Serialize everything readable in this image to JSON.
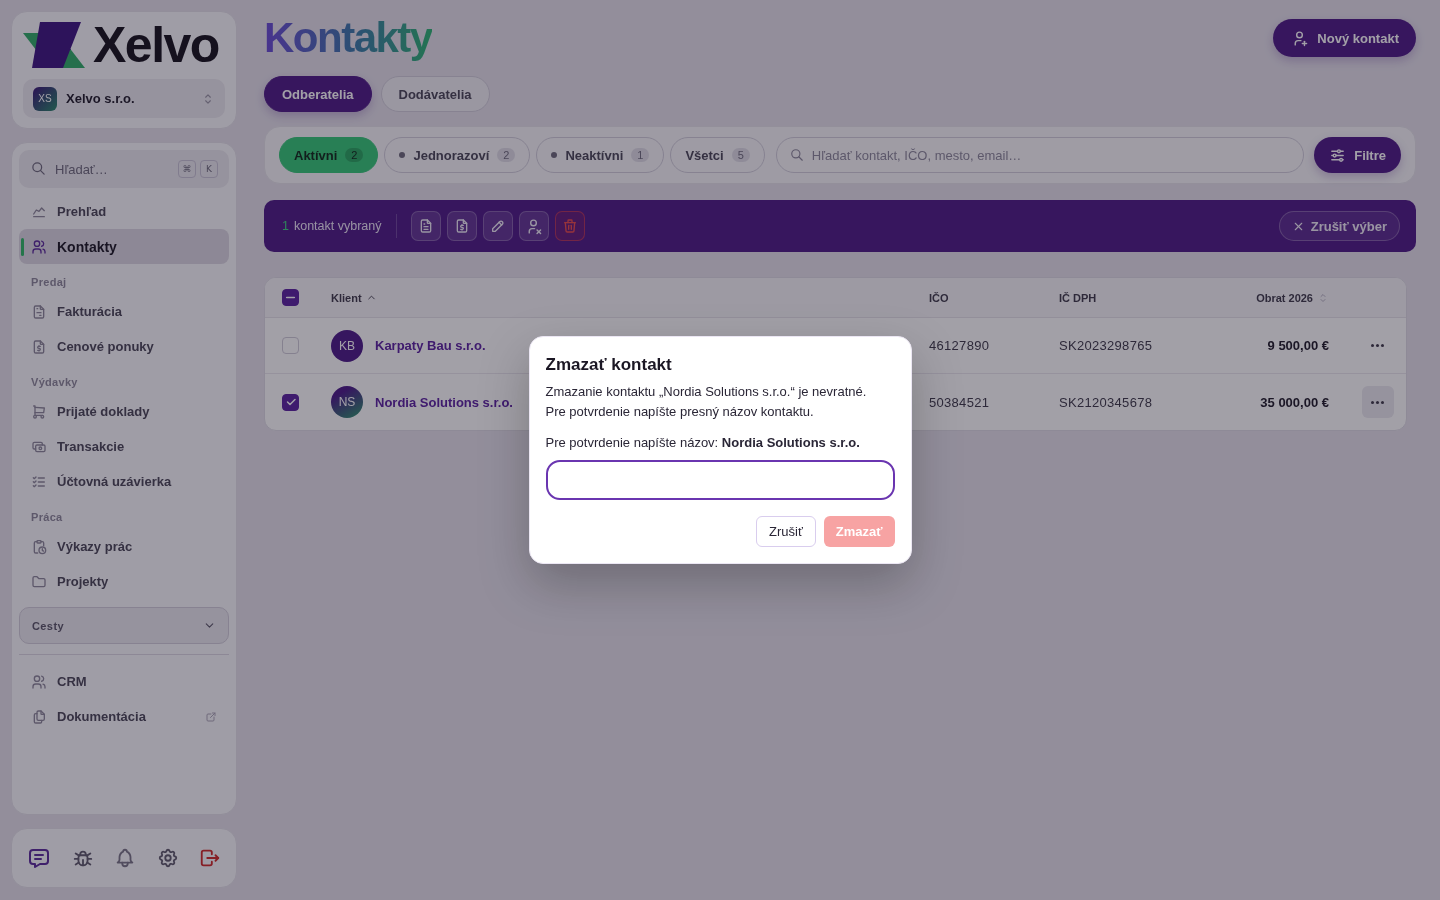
{
  "sidebar": {
    "brand": "Xelvo",
    "company": {
      "initials": "XS",
      "name": "Xelvo s.r.o."
    },
    "search": {
      "placeholder": "Hľadať…",
      "keys": [
        "⌘",
        "K"
      ]
    },
    "nav": [
      {
        "kind": "link",
        "label": "Prehľad",
        "selected": false,
        "external": false
      },
      {
        "kind": "link",
        "label": "Kontakty",
        "selected": true,
        "external": false
      },
      {
        "kind": "heading",
        "label": "Predaj"
      },
      {
        "kind": "link",
        "label": "Fakturácia",
        "selected": false,
        "external": false
      },
      {
        "kind": "link",
        "label": "Cenové ponuky",
        "selected": false,
        "external": false
      },
      {
        "kind": "heading",
        "label": "Výdavky"
      },
      {
        "kind": "link",
        "label": "Prijaté doklady",
        "selected": false,
        "external": false
      },
      {
        "kind": "link",
        "label": "Transakcie",
        "selected": false,
        "external": false
      },
      {
        "kind": "link",
        "label": "Účtovná uzávierka",
        "selected": false,
        "external": false
      },
      {
        "kind": "heading",
        "label": "Práca"
      },
      {
        "kind": "link",
        "label": "Výkazy prác",
        "selected": false,
        "external": false
      },
      {
        "kind": "link",
        "label": "Projekty",
        "selected": false,
        "external": false
      },
      {
        "kind": "group",
        "label": "Cesty",
        "expanded": false
      },
      {
        "kind": "divider"
      },
      {
        "kind": "link",
        "label": "CRM",
        "selected": false,
        "external": false
      },
      {
        "kind": "link",
        "label": "Dokumentácia",
        "selected": false,
        "external": true
      }
    ]
  },
  "header": {
    "title": "Kontakty",
    "new_button": "Nový kontakt"
  },
  "tabs": [
    {
      "label": "Odberatelia",
      "selected": true
    },
    {
      "label": "Dodávatelia",
      "selected": false
    }
  ],
  "filters": {
    "statuses": [
      {
        "label": "Aktívni",
        "count": "2",
        "selected": true,
        "dot": false
      },
      {
        "label": "Jednorazoví",
        "count": "2",
        "selected": false,
        "dot": true
      },
      {
        "label": "Neaktívni",
        "count": "1",
        "selected": false,
        "dot": true
      },
      {
        "label": "Všetci",
        "count": "5",
        "selected": false,
        "dot": false
      }
    ],
    "search": {
      "placeholder": "Hľadať kontakt, IČO, mesto, email…"
    },
    "button": "Filtre"
  },
  "selection_bar": {
    "count": "1",
    "label": "kontakt vybraný",
    "clear_button": "Zrušiť výber"
  },
  "table": {
    "select_all": {
      "indeterminate": true
    },
    "columns": [
      {
        "label": "Klient",
        "sortable": true,
        "sorted": true
      },
      {
        "label": "IČO",
        "sortable": false,
        "sorted": false
      },
      {
        "label": "IČ DPH",
        "sortable": false,
        "sorted": false
      },
      {
        "label": "Obrat 2026",
        "sortable": true,
        "sorted": false
      }
    ],
    "rows": [
      {
        "selected": false,
        "initials": "KB",
        "avatar_gradient": false,
        "name": "Karpaty Bau s.r.o.",
        "ico": "46127890",
        "ic_dph": "SK2023298765",
        "turnover": "9 500,00 €",
        "menu_highlighted": false
      },
      {
        "selected": true,
        "initials": "NS",
        "avatar_gradient": true,
        "name": "Nordia Solutions s.r.o.",
        "ico": "50384521",
        "ic_dph": "SK2120345678",
        "turnover": "35 000,00 €",
        "menu_highlighted": true
      }
    ]
  },
  "modal": {
    "title": "Zmazať kontakt",
    "message": [
      "Zmazanie kontaktu „Nordia Solutions s.r.o.“ je nevratné.",
      "Pre potvrdenie napíšte presný názov kontaktu."
    ],
    "confirm_label": "Pre potvrdenie napíšte názov: **Nordia Solutions s.r.o.**",
    "input": {
      "focused": true
    },
    "cancel_button": "Zrušiť",
    "delete_button": {
      "label": "Zmazať",
      "disabled": true
    }
  }
}
